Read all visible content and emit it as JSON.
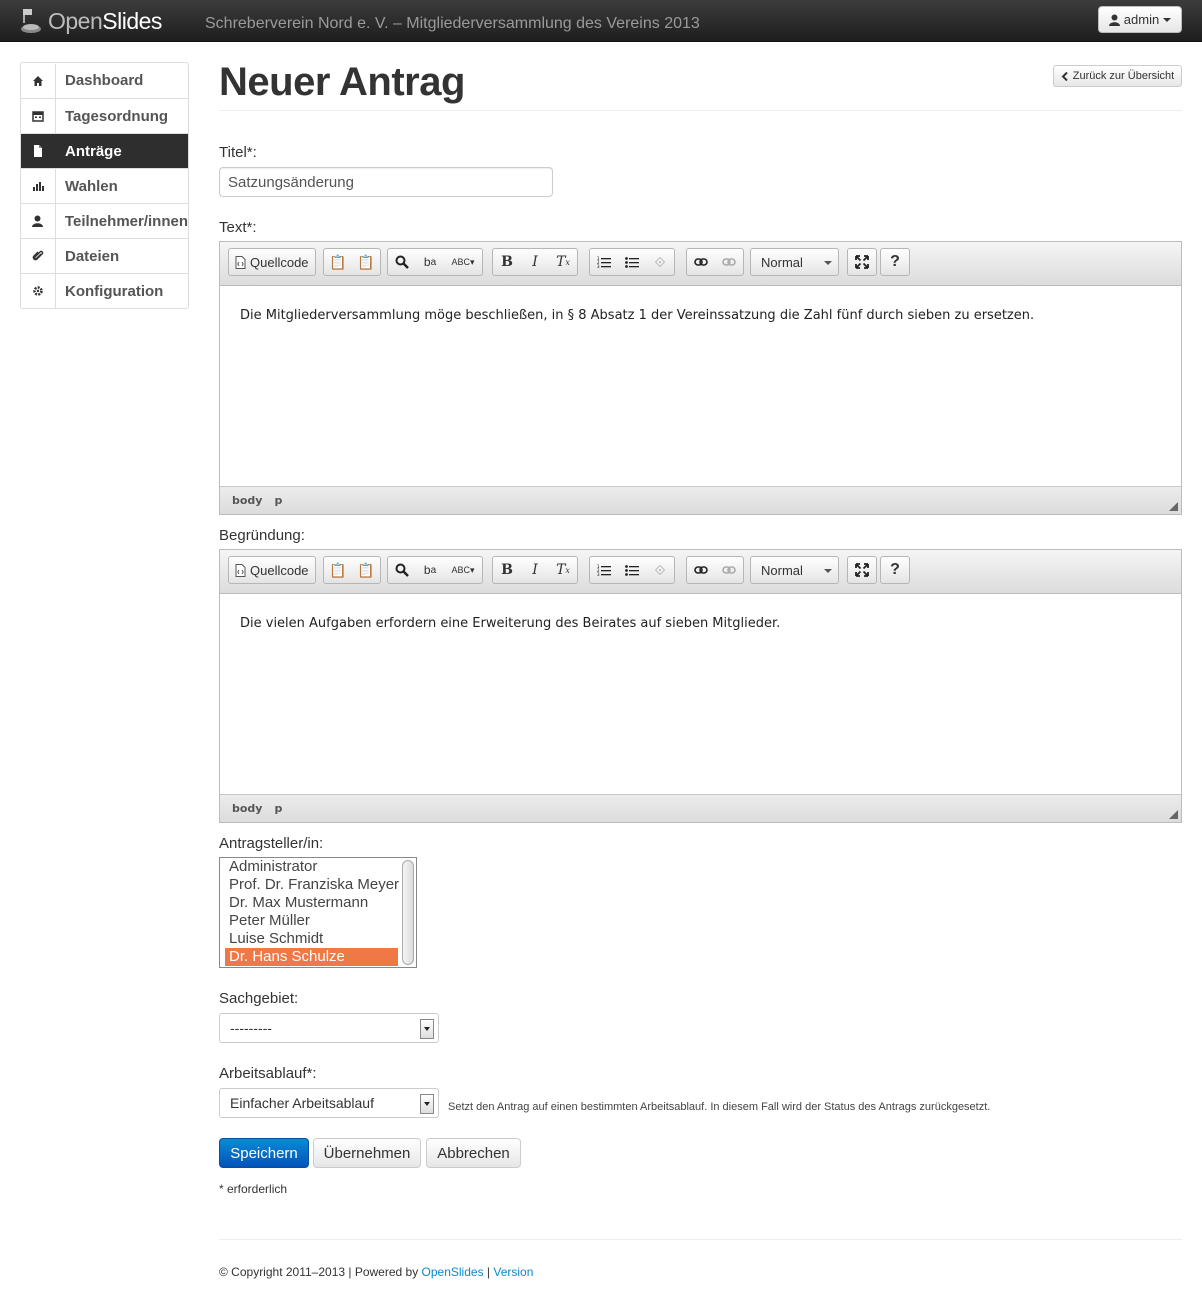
{
  "navbar": {
    "logo_light": "Open",
    "logo_bold": "Slides",
    "event_title": "Schreberverein Nord e. V. – Mitgliederversammlung des Vereins 2013",
    "user_label": "admin"
  },
  "sidebar": {
    "items": [
      {
        "label": "Dashboard",
        "icon": "home-icon",
        "active": false
      },
      {
        "label": "Tagesordnung",
        "icon": "calendar-icon",
        "active": false
      },
      {
        "label": "Anträge",
        "icon": "file-icon",
        "active": true
      },
      {
        "label": "Wahlen",
        "icon": "bar-chart-icon",
        "active": false
      },
      {
        "label": "Teilnehmer/innen",
        "icon": "user-icon",
        "active": false
      },
      {
        "label": "Dateien",
        "icon": "paperclip-icon",
        "active": false
      },
      {
        "label": "Konfiguration",
        "icon": "gear-icon",
        "active": false
      }
    ]
  },
  "page": {
    "title": "Neuer Antrag",
    "back_button": "Zurück zur Übersicht"
  },
  "form": {
    "title_label": "Titel*:",
    "title_value": "Satzungsänderung",
    "text_label": "Text*:",
    "text_value": "Die Mitgliederversammlung möge beschließen, in § 8 Absatz 1 der Vereinssatzung die Zahl fünf durch sieben zu ersetzen.",
    "reason_label": "Begründung:",
    "reason_value": "Die vielen Aufgaben erfordern eine Erweiterung des Beirates auf sieben Mitglieder.",
    "submitter_label": "Antragsteller/in:",
    "submitters": [
      {
        "label": "Administrator",
        "selected": false
      },
      {
        "label": "Prof. Dr. Franziska Meyer",
        "selected": false
      },
      {
        "label": "Dr. Max Mustermann",
        "selected": false
      },
      {
        "label": "Peter Müller",
        "selected": false
      },
      {
        "label": "Luise Schmidt",
        "selected": false
      },
      {
        "label": "Dr. Hans Schulze",
        "selected": true
      }
    ],
    "category_label": "Sachgebiet:",
    "category_value": "---------",
    "workflow_label": "Arbeitsablauf*:",
    "workflow_value": "Einfacher Arbeitsablauf",
    "workflow_hint": "Setzt den Antrag auf einen bestimmten Arbeitsablauf. In diesem Fall wird der Status des Antrags zurückgesetzt.",
    "required_note": "* erforderlich"
  },
  "editor": {
    "source_label": "Quellcode",
    "format_value": "Normal",
    "path_body": "body",
    "path_p": "p"
  },
  "buttons": {
    "save": "Speichern",
    "apply": "Übernehmen",
    "cancel": "Abbrechen"
  },
  "footer": {
    "copyright": "© Copyright 2011–2013 | Powered by ",
    "link1": "OpenSlides",
    "sep": " | ",
    "link2": "Version"
  },
  "colors": {
    "primary": "#0a6fcc",
    "selection": "#f07746",
    "navbar": "#2a2a2a",
    "link": "#0b88cc"
  }
}
